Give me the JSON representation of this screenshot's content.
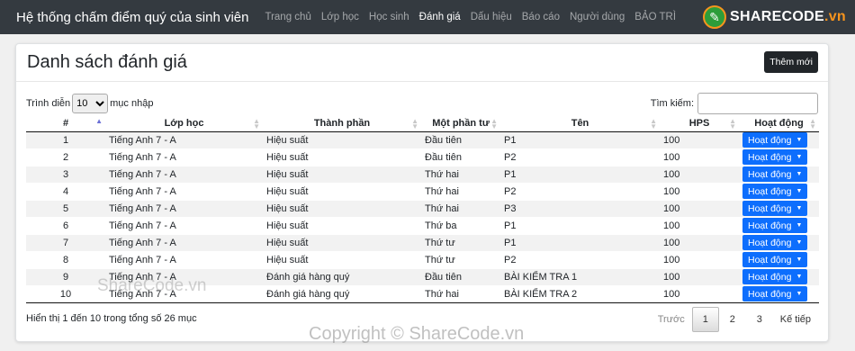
{
  "app": {
    "title": "Hệ thống chấm điểm quý của sinh viên",
    "nav": [
      "Trang chủ",
      "Lớp học",
      "Học sinh",
      "Đánh giá",
      "Dấu hiệu",
      "Báo cáo",
      "Người dùng",
      "BẢO TRÌ"
    ],
    "active_nav": "Đánh giá",
    "logo": {
      "brand": "SHARECODE",
      "suffix": ".vn"
    }
  },
  "page": {
    "title": "Danh sách đánh giá",
    "add_label": "Thêm mới"
  },
  "length": {
    "before": "Trình diễn",
    "value": "10",
    "after": "mục nhập"
  },
  "search": {
    "label": "Tìm kiếm:",
    "value": ""
  },
  "table": {
    "columns": [
      "#",
      "Lớp học",
      "Thành phần",
      "Một phần tư",
      "Tên",
      "HPS",
      "Hoạt động"
    ],
    "rows": [
      [
        "1",
        "Tiếng Anh 7 - A",
        "Hiệu suất",
        "Đầu tiên",
        "P1",
        "100",
        "Hoạt động"
      ],
      [
        "2",
        "Tiếng Anh 7 - A",
        "Hiệu suất",
        "Đầu tiên",
        "P2",
        "100",
        "Hoạt động"
      ],
      [
        "3",
        "Tiếng Anh 7 - A",
        "Hiệu suất",
        "Thứ hai",
        "P1",
        "100",
        "Hoạt động"
      ],
      [
        "4",
        "Tiếng Anh 7 - A",
        "Hiệu suất",
        "Thứ hai",
        "P2",
        "100",
        "Hoạt động"
      ],
      [
        "5",
        "Tiếng Anh 7 - A",
        "Hiệu suất",
        "Thứ hai",
        "P3",
        "100",
        "Hoạt động"
      ],
      [
        "6",
        "Tiếng Anh 7 - A",
        "Hiệu suất",
        "Thứ ba",
        "P1",
        "100",
        "Hoạt động"
      ],
      [
        "7",
        "Tiếng Anh 7 - A",
        "Hiệu suất",
        "Thứ tư",
        "P1",
        "100",
        "Hoạt động"
      ],
      [
        "8",
        "Tiếng Anh 7 - A",
        "Hiệu suất",
        "Thứ tư",
        "P2",
        "100",
        "Hoạt động"
      ],
      [
        "9",
        "Tiếng Anh 7 - A",
        "Đánh giá hàng quý",
        "Đầu tiên",
        "BÀI KIỂM TRA 1",
        "100",
        "Hoạt động"
      ],
      [
        "10",
        "Tiếng Anh 7 - A",
        "Đánh giá hàng quý",
        "Thứ hai",
        "BÀI KIỂM TRA 2",
        "100",
        "Hoạt động"
      ]
    ]
  },
  "info": "Hiển thị 1 đến 10 trong tổng số 26 mục",
  "pagination": {
    "prev": "Trước",
    "pages": [
      "1",
      "2",
      "3"
    ],
    "current": "1",
    "next": "Kế tiếp"
  },
  "watermarks": {
    "overlay": "ShareCode.vn",
    "bottom": "Copyright © ShareCode.vn"
  },
  "colors": {
    "navbar": "#343a40",
    "action_button": "#0d6efd",
    "add_button": "#212529"
  }
}
